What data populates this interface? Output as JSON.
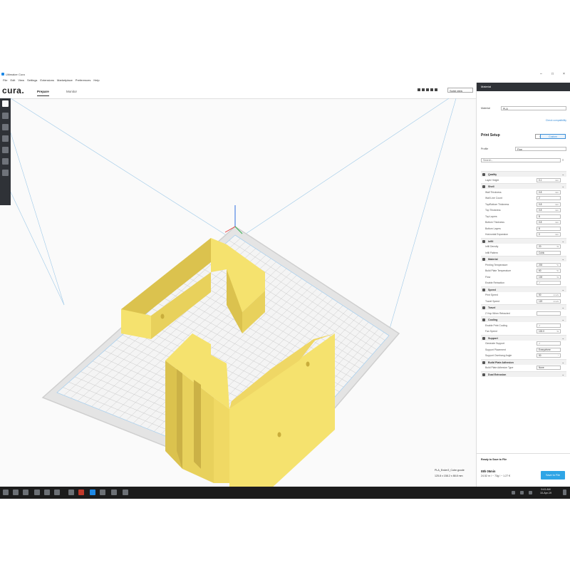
{
  "window": {
    "title": "Ultimaker Cura",
    "controls": [
      "–",
      "□",
      "×"
    ]
  },
  "menu": [
    "File",
    "Edit",
    "View",
    "Settings",
    "Extensions",
    "Marketplace",
    "Preferences",
    "Help"
  ],
  "header": {
    "logo": "cura.",
    "stages": [
      {
        "label": "Prepare",
        "active": true
      },
      {
        "label": "Monitor",
        "active": false
      }
    ],
    "view_mode": "Solid view"
  },
  "left_tools": [
    "open-file",
    "move",
    "scale",
    "rotate",
    "mirror",
    "per-model-settings",
    "support-blocker"
  ],
  "object_info": {
    "name": "PLA_Ender3_Cube.gcode",
    "dimensions": "125.8 x 158.2 x 88.8 mm"
  },
  "panel": {
    "header": "Material",
    "material_label": "Material",
    "material_value": "PLA",
    "check_compat": "Check compatibility",
    "print_setup": "Print Setup",
    "mode_recommended": "Recommended",
    "mode_custom": "Custom",
    "profile_label": "Profile",
    "profile_value": "Fine",
    "search_placeholder": "Search...",
    "categories": [
      {
        "name": "Quality",
        "settings": [
          {
            "label": "Layer Height",
            "value": "0.1",
            "unit": "mm"
          }
        ]
      },
      {
        "name": "Shell",
        "settings": [
          {
            "label": "Wall Thickness",
            "value": "0.8",
            "unit": "mm"
          },
          {
            "label": "Wall Line Count",
            "value": "2",
            "unit": ""
          },
          {
            "label": "Top/Bottom Thickness",
            "value": "0.8",
            "unit": "mm"
          },
          {
            "label": "Top Thickness",
            "value": "0.8",
            "unit": "mm"
          },
          {
            "label": "Top Layers",
            "value": "8",
            "unit": ""
          },
          {
            "label": "Bottom Thickness",
            "value": "0.8",
            "unit": "mm"
          },
          {
            "label": "Bottom Layers",
            "value": "8",
            "unit": ""
          },
          {
            "label": "Horizontal Expansion",
            "value": "0",
            "unit": "mm"
          }
        ]
      },
      {
        "name": "Infill",
        "settings": [
          {
            "label": "Infill Density",
            "value": "20",
            "unit": "%"
          },
          {
            "label": "Infill Pattern",
            "value": "Cubic",
            "unit": ""
          }
        ]
      },
      {
        "name": "Material",
        "settings": [
          {
            "label": "Printing Temperature",
            "value": "200",
            "unit": "°C"
          },
          {
            "label": "Build Plate Temperature",
            "value": "60",
            "unit": "°C"
          },
          {
            "label": "Flow",
            "value": "100",
            "unit": "%"
          },
          {
            "label": "Enable Retraction",
            "value": "✓",
            "unit": ""
          }
        ]
      },
      {
        "name": "Speed",
        "settings": [
          {
            "label": "Print Speed",
            "value": "50",
            "unit": "mm/s"
          },
          {
            "label": "Travel Speed",
            "value": "120",
            "unit": "mm/s"
          }
        ]
      },
      {
        "name": "Travel",
        "settings": [
          {
            "label": "Z Hop When Retracted",
            "value": "",
            "unit": ""
          }
        ]
      },
      {
        "name": "Cooling",
        "settings": [
          {
            "label": "Enable Print Cooling",
            "value": "✓",
            "unit": ""
          },
          {
            "label": "Fan Speed",
            "value": "100.0",
            "unit": "%"
          }
        ]
      },
      {
        "name": "Support",
        "settings": [
          {
            "label": "Generate Support",
            "value": "✓",
            "unit": ""
          },
          {
            "label": "Support Placement",
            "value": "Everywhere",
            "unit": ""
          },
          {
            "label": "Support Overhang Angle",
            "value": "50",
            "unit": "°"
          }
        ]
      },
      {
        "name": "Build Plate Adhesion",
        "settings": [
          {
            "label": "Build Plate Adhesion Type",
            "value": "None",
            "unit": ""
          }
        ]
      },
      {
        "name": "Dual Extrusion",
        "settings": []
      }
    ],
    "status": "Ready to Save to File",
    "print_time": "08h 05min",
    "material_usage": "24.52 m / ~ 73g / ~ 1.27 €",
    "save_button": "Save to File"
  },
  "taskbar": {
    "time": "9:41 AM",
    "date": "10-Apr-19"
  },
  "colors": {
    "model": "#f5e26e",
    "model_side": "#dbc24e",
    "grid_line": "#c8c8c8",
    "plate": "#f4f4f4",
    "accent": "#2fa5e6",
    "dark": "#2f3237"
  }
}
